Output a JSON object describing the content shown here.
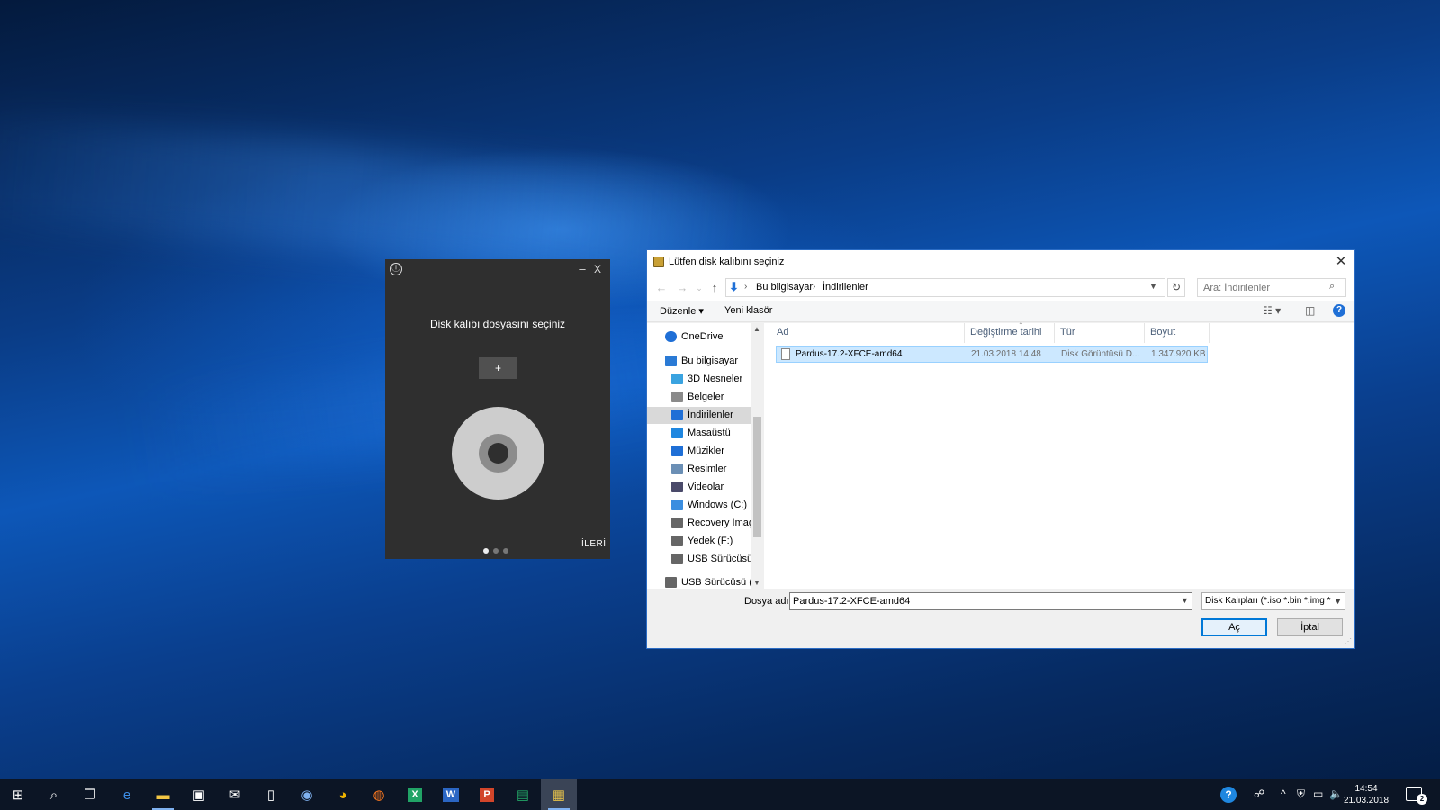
{
  "etcher": {
    "info_icon": "ⓘ",
    "minimize": "–",
    "close": "X",
    "title": "Disk kalıbı dosyasını seçiniz",
    "plus_label": "+",
    "next_label": "İLERİ",
    "steps": 3,
    "active_step": 1
  },
  "dialog": {
    "title": "Lütfen disk kalıbını seçiniz",
    "close": "✕",
    "nav": {
      "back": "←",
      "forward": "→",
      "recent": "⌄",
      "up": "↑",
      "refresh": "↻"
    },
    "breadcrumb": [
      "Bu bilgisayar",
      "İndirilenler"
    ],
    "search_placeholder": "Ara: İndirilenler",
    "toolbar": {
      "organize": "Düzenle ▾",
      "new_folder": "Yeni klasör"
    },
    "sidebar": [
      {
        "label": "OneDrive",
        "icon": "cloud-icon",
        "color": "#1f6fd6"
      },
      {
        "label": "Bu bilgisayar",
        "icon": "computer-icon",
        "color": "#2a7ad5"
      },
      {
        "label": "3D Nesneler",
        "icon": "cube-icon",
        "color": "#3aa3e0"
      },
      {
        "label": "Belgeler",
        "icon": "document-icon",
        "color": "#8a8a8a"
      },
      {
        "label": "İndirilenler",
        "icon": "download-icon",
        "color": "#1f6fd6",
        "selected": true
      },
      {
        "label": "Masaüstü",
        "icon": "desktop-icon",
        "color": "#1f87e0"
      },
      {
        "label": "Müzikler",
        "icon": "music-icon",
        "color": "#1f6fd6"
      },
      {
        "label": "Resimler",
        "icon": "pictures-icon",
        "color": "#6b8fb5"
      },
      {
        "label": "Videolar",
        "icon": "video-icon",
        "color": "#4a4a6a"
      },
      {
        "label": "Windows (C:)",
        "icon": "windows-drive-icon",
        "color": "#3b8ee0"
      },
      {
        "label": "Recovery Image",
        "icon": "drive-icon",
        "color": "#666666"
      },
      {
        "label": "Yedek (F:)",
        "icon": "drive-icon",
        "color": "#666666"
      },
      {
        "label": "USB Sürücüsü (G",
        "icon": "usb-drive-icon",
        "color": "#666666"
      },
      {
        "label": "USB Sürücüsü (G:)",
        "icon": "usb-drive-icon",
        "color": "#666666"
      }
    ],
    "columns": [
      "Ad",
      "Değiştirme tarihi",
      "Tür",
      "Boyut"
    ],
    "files": [
      {
        "name": "Pardus-17.2-XFCE-amd64",
        "modified": "21.03.2018 14:48",
        "type": "Disk Görüntüsü D...",
        "size": "1.347.920 KB"
      }
    ],
    "filename_label": "Dosya adı:",
    "filename_value": "Pardus-17.2-XFCE-amd64",
    "filter": "Disk Kalıpları (*.iso *.bin *.img *",
    "open_label": "Aç",
    "cancel_label": "İptal"
  },
  "taskbar": {
    "apps": [
      {
        "name": "start",
        "glyph": "⊞",
        "color": "#ffffff"
      },
      {
        "name": "search",
        "glyph": "⌕",
        "color": "#ffffff"
      },
      {
        "name": "task-view",
        "glyph": "❐",
        "color": "#ffffff"
      },
      {
        "name": "edge",
        "glyph": "e",
        "color": "#3d8ee8"
      },
      {
        "name": "file-explorer",
        "glyph": "▬",
        "color": "#f3c644"
      },
      {
        "name": "store",
        "glyph": "▣",
        "color": "#ffffff"
      },
      {
        "name": "mail",
        "glyph": "✉",
        "color": "#ffffff"
      },
      {
        "name": "notepad",
        "glyph": "▯",
        "color": "#ffffff"
      },
      {
        "name": "network-app",
        "glyph": "◉",
        "color": "#7fb1f0"
      },
      {
        "name": "chrome",
        "glyph": "◕",
        "color": "#f0b400"
      },
      {
        "name": "firefox",
        "glyph": "◍",
        "color": "#ff7a1f"
      },
      {
        "name": "excel",
        "glyph": "X",
        "color": "#21a366"
      },
      {
        "name": "word",
        "glyph": "W",
        "color": "#2b66c4"
      },
      {
        "name": "powerpoint",
        "glyph": "P",
        "color": "#d2452a"
      },
      {
        "name": "sheets",
        "glyph": "▤",
        "color": "#23a566"
      },
      {
        "name": "etcher",
        "glyph": "▦",
        "color": "#e8c34a"
      }
    ],
    "tray": {
      "help": "?",
      "people": "☍",
      "chevron": "^",
      "shield": "⛨",
      "network": "▭",
      "volume": "🔈"
    },
    "time": "14:54",
    "date": "21.03.2018",
    "notifications": "2"
  }
}
